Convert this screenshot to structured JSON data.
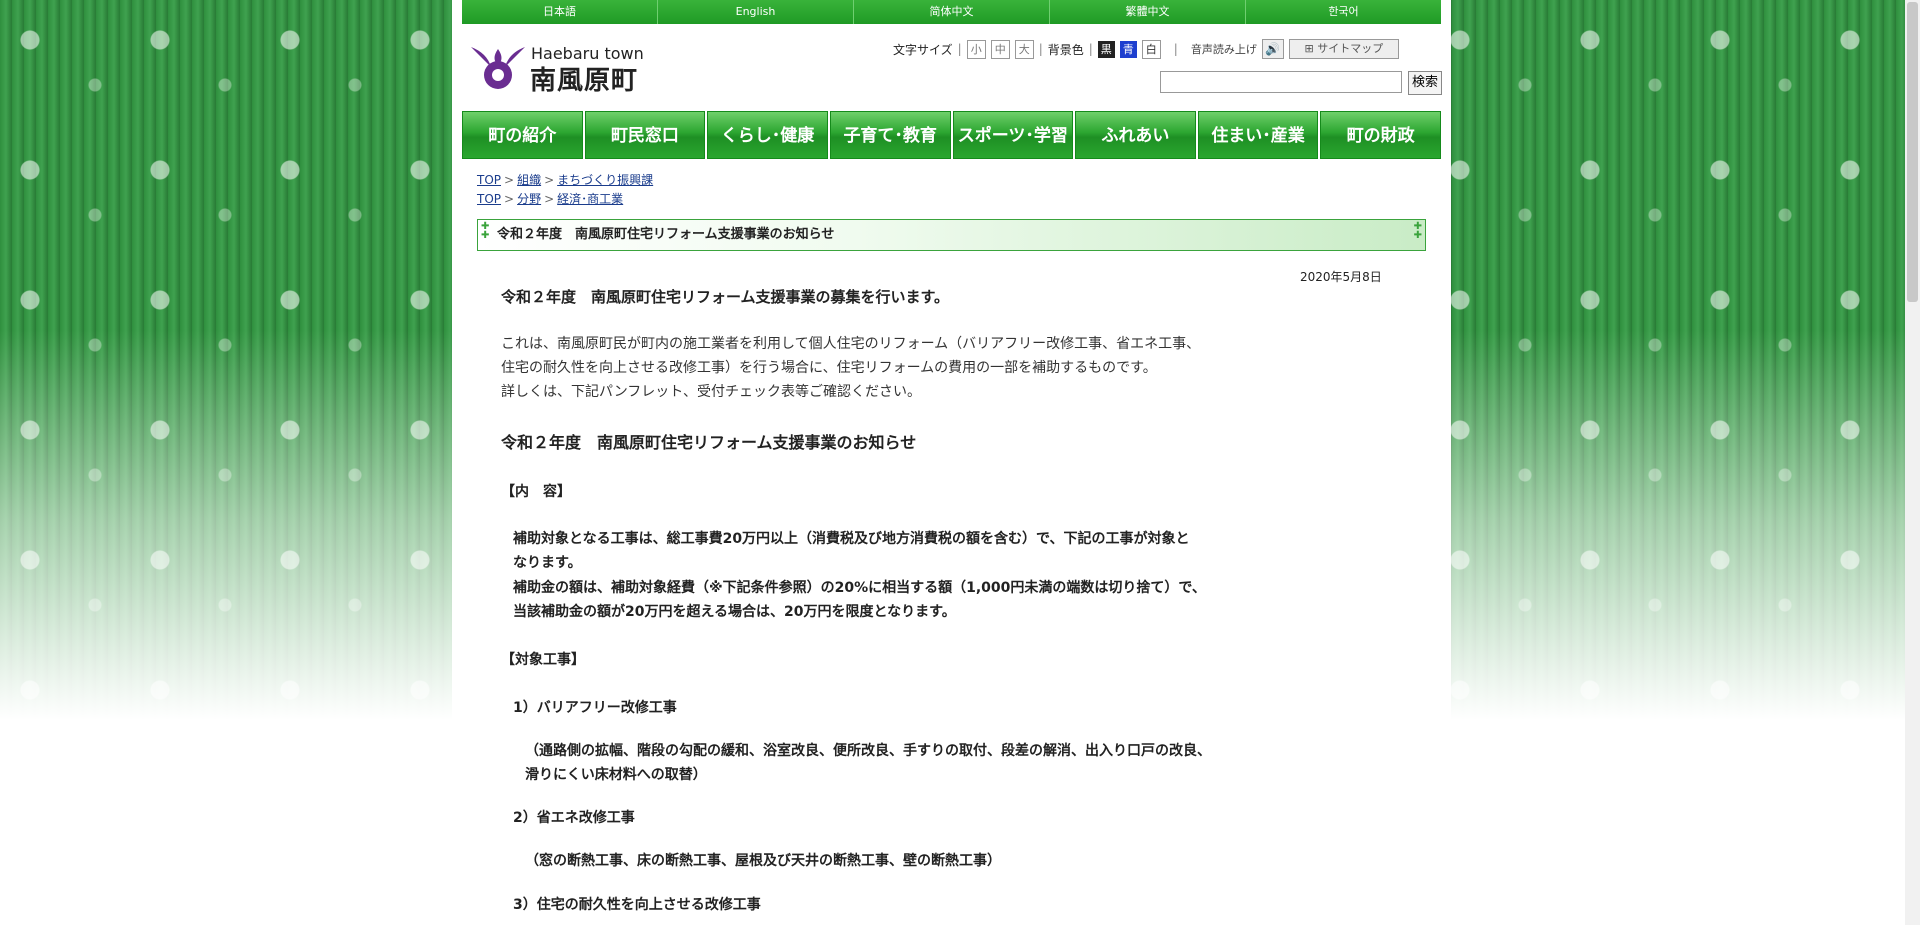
{
  "languages": [
    "日本語",
    "English",
    "简体中文",
    "繁體中文",
    "한국어"
  ],
  "logo": {
    "en": "Haebaru town",
    "jp": "南風原町"
  },
  "tools": {
    "font_size_label": "文字サイズ",
    "sizes": [
      "小",
      "中",
      "大"
    ],
    "bg_label": "背景色",
    "bg_options": [
      {
        "label": "黒",
        "color": "#222222",
        "text": "#ffffff"
      },
      {
        "label": "青",
        "color": "#1e3fcf",
        "text": "#ffffff"
      },
      {
        "label": "白",
        "color": "#ffffff",
        "text": "#333333"
      }
    ],
    "read_aloud_label": "音声読み上げ",
    "sitemap_label": "サイトマップ"
  },
  "search": {
    "value": "",
    "button": "検索"
  },
  "nav": [
    "町の紹介",
    "町民窓口",
    "くらし･健康",
    "子育て･教育",
    "スポーツ･学習",
    "ふれあい",
    "住まい･産業",
    "町の財政"
  ],
  "breadcrumbs": [
    [
      "TOP",
      "組織",
      "まちづくり振興課"
    ],
    [
      "TOP",
      "分野",
      "経済･商工業"
    ]
  ],
  "page": {
    "title": "令和２年度　南風原町住宅リフォーム支援事業のお知らせ",
    "date": "2020年5月8日",
    "lead": "令和２年度　南風原町住宅リフォーム支援事業の募集を行います。",
    "intro": [
      "これは、南風原町民が町内の施工業者を利用して個人住宅のリフォーム（バリアフリー改修工事、省エネ工事、",
      "住宅の耐久性を向上させる改修工事）を行う場合に、住宅リフォームの費用の一部を補助するものです。",
      "詳しくは、下記パンフレット、受付チェック表等ご確認ください。"
    ],
    "heading": "令和２年度　南風原町住宅リフォーム支援事業のお知らせ",
    "section_content": "【内　容】",
    "content_lines": [
      "補助対象となる工事は、総工事費20万円以上（消費税及び地方消費税の額を含む）で、下記の工事が対象と",
      "なります。",
      "補助金の額は、補助対象経費（※下記条件参照）の20%に相当する額（1,000円未満の端数は切り捨て）で、",
      "当該補助金の額が20万円を超える場合は、20万円を限度となります。"
    ],
    "section_target": "【対象工事】",
    "item1": "1）バリアフリー改修工事",
    "item1_detail": [
      "（通路側の拡幅、階段の勾配の緩和、浴室改良、便所改良、手すりの取付、段差の解消、出入り口戸の改良、",
      "滑りにくい床材料への取替）"
    ],
    "item2": "2）省エネ改修工事",
    "item2_detail": "（窓の断熱工事、床の断熱工事、屋根及び天井の断熱工事、壁の断熱工事）",
    "item3": "3）住宅の耐久性を向上させる改修工事"
  }
}
